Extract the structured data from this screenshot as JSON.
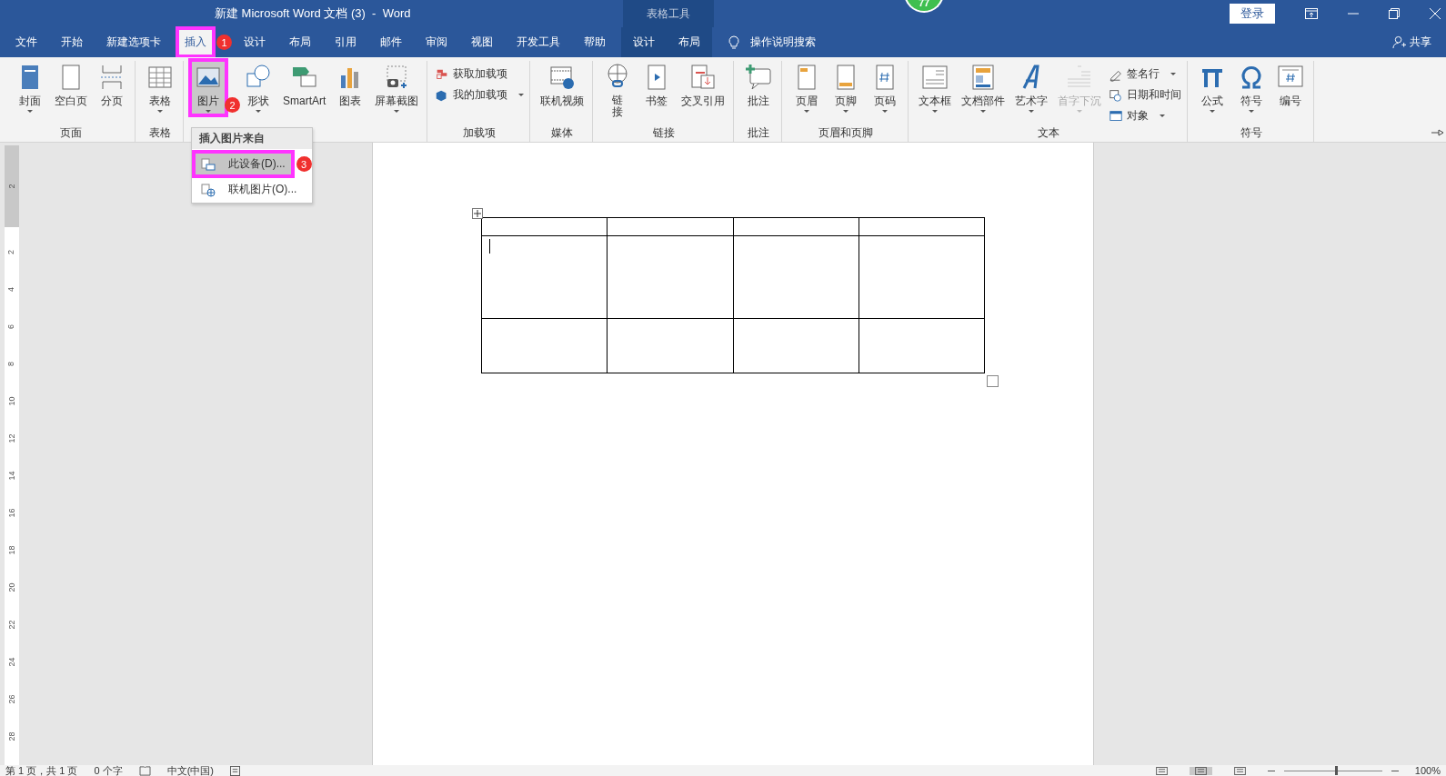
{
  "window": {
    "title": "新建 Microsoft Word 文档 (3)  -  Word",
    "context_label": "表格工具",
    "sign_in": "登录",
    "badge": "77"
  },
  "tabs": [
    {
      "label": "文件",
      "selected": false,
      "contextual": false,
      "highlighted": false
    },
    {
      "label": "开始",
      "selected": false,
      "contextual": false,
      "highlighted": false
    },
    {
      "label": "新建选项卡",
      "selected": false,
      "contextual": false,
      "highlighted": false
    },
    {
      "label": "插入",
      "selected": true,
      "contextual": false,
      "highlighted": true
    },
    {
      "label": "设计",
      "selected": false,
      "contextual": false,
      "highlighted": false
    },
    {
      "label": "布局",
      "selected": false,
      "contextual": false,
      "highlighted": false
    },
    {
      "label": "引用",
      "selected": false,
      "contextual": false,
      "highlighted": false
    },
    {
      "label": "邮件",
      "selected": false,
      "contextual": false,
      "highlighted": false
    },
    {
      "label": "审阅",
      "selected": false,
      "contextual": false,
      "highlighted": false
    },
    {
      "label": "视图",
      "selected": false,
      "contextual": false,
      "highlighted": false
    },
    {
      "label": "开发工具",
      "selected": false,
      "contextual": false,
      "highlighted": false
    },
    {
      "label": "帮助",
      "selected": false,
      "contextual": false,
      "highlighted": false
    },
    {
      "label": "设计",
      "selected": false,
      "contextual": true,
      "highlighted": false
    },
    {
      "label": "布局",
      "selected": false,
      "contextual": true,
      "highlighted": false
    }
  ],
  "tell_me": "操作说明搜索",
  "share": "共享",
  "ribbon": [
    {
      "label": "页面",
      "items": [
        {
          "kind": "large",
          "label": "封面",
          "dropdown": true,
          "disabled": false,
          "highlighted": false
        },
        {
          "kind": "large",
          "label": "空白页",
          "dropdown": false,
          "disabled": false,
          "highlighted": false
        },
        {
          "kind": "large",
          "label": "分页",
          "dropdown": false,
          "disabled": false,
          "highlighted": false
        }
      ]
    },
    {
      "label": "表格",
      "items": [
        {
          "kind": "large",
          "label": "表格",
          "dropdown": true,
          "disabled": false,
          "highlighted": false
        }
      ]
    },
    {
      "items": [
        {
          "kind": "large",
          "label": "图片",
          "dropdown": true,
          "disabled": false,
          "highlighted": true
        },
        {
          "kind": "large",
          "label": "形状",
          "dropdown": true,
          "disabled": false,
          "highlighted": false
        },
        {
          "kind": "large",
          "label": "SmartArt",
          "dropdown": false,
          "disabled": false,
          "highlighted": false
        },
        {
          "kind": "large",
          "label": "图表",
          "dropdown": false,
          "disabled": false,
          "highlighted": false
        },
        {
          "kind": "large",
          "label": "屏幕截图",
          "dropdown": true,
          "disabled": false,
          "highlighted": false
        }
      ]
    },
    {
      "label": "加载项",
      "items": [
        {
          "kind": "small",
          "label": "获取加载项",
          "dropdown": false,
          "disabled": false,
          "highlighted": false
        },
        {
          "kind": "small",
          "label": "我的加载项",
          "dropdown": true,
          "disabled": false,
          "highlighted": false
        }
      ]
    },
    {
      "label": "媒体",
      "items": [
        {
          "kind": "large",
          "label": "联机视频",
          "dropdown": false,
          "disabled": false,
          "highlighted": false
        }
      ]
    },
    {
      "label": "链接",
      "items": [
        {
          "kind": "stacked",
          "label": "链接",
          "dropdown": false,
          "disabled": false,
          "highlighted": false
        },
        {
          "kind": "large",
          "label": "书签",
          "dropdown": false,
          "disabled": false,
          "highlighted": false
        },
        {
          "kind": "large",
          "label": "交叉引用",
          "dropdown": false,
          "disabled": false,
          "highlighted": false
        }
      ]
    },
    {
      "label": "批注",
      "items": [
        {
          "kind": "large",
          "label": "批注",
          "dropdown": false,
          "disabled": false,
          "highlighted": false
        }
      ]
    },
    {
      "label": "页眉和页脚",
      "items": [
        {
          "kind": "large",
          "label": "页眉",
          "dropdown": true,
          "disabled": false,
          "highlighted": false
        },
        {
          "kind": "large",
          "label": "页脚",
          "dropdown": true,
          "disabled": false,
          "highlighted": false
        },
        {
          "kind": "large",
          "label": "页码",
          "dropdown": true,
          "disabled": false,
          "highlighted": false
        }
      ]
    },
    {
      "label": "文本",
      "items": [
        {
          "kind": "large",
          "label": "文本框",
          "dropdown": true,
          "disabled": false,
          "highlighted": false
        },
        {
          "kind": "large",
          "label": "文档部件",
          "dropdown": true,
          "disabled": false,
          "highlighted": false
        },
        {
          "kind": "large",
          "label": "艺术字",
          "dropdown": true,
          "disabled": false,
          "highlighted": false
        },
        {
          "kind": "large",
          "label": "首字下沉",
          "dropdown": true,
          "disabled": true,
          "highlighted": false
        },
        {
          "kind": "small",
          "label": "签名行",
          "dropdown": true,
          "disabled": false,
          "highlighted": false
        },
        {
          "kind": "small",
          "label": "日期和时间",
          "dropdown": false,
          "disabled": false,
          "highlighted": false
        },
        {
          "kind": "small",
          "label": "对象",
          "dropdown": true,
          "disabled": false,
          "highlighted": false
        }
      ]
    },
    {
      "label": "符号",
      "items": [
        {
          "kind": "large",
          "label": "公式",
          "dropdown": true,
          "disabled": false,
          "highlighted": false
        },
        {
          "kind": "large",
          "label": "符号",
          "dropdown": true,
          "disabled": false,
          "highlighted": false
        },
        {
          "kind": "large",
          "label": "编号",
          "dropdown": false,
          "disabled": false,
          "highlighted": false
        }
      ]
    }
  ],
  "menu": {
    "header": "插入图片来自",
    "items": [
      {
        "label": "此设备(D)...",
        "selected": true,
        "highlighted": true
      },
      {
        "label": "联机图片(O)...",
        "selected": false,
        "highlighted": false
      }
    ]
  },
  "annotations": [
    {
      "number": "1"
    },
    {
      "number": "2"
    },
    {
      "number": "3"
    }
  ],
  "ruler": [
    "2",
    "2",
    "4",
    "6",
    "8",
    "10",
    "12",
    "14",
    "16",
    "18",
    "20",
    "22",
    "24",
    "26",
    "28"
  ],
  "table": {
    "rows": [
      {
        "kind": "short",
        "cells": [
          {
            "cursor": false
          },
          {
            "cursor": false
          },
          {
            "cursor": false
          },
          {
            "cursor": false
          }
        ]
      },
      {
        "kind": "tall",
        "cells": [
          {
            "cursor": true
          },
          {
            "cursor": false
          },
          {
            "cursor": false
          },
          {
            "cursor": false
          }
        ]
      },
      {
        "kind": "medium",
        "cells": [
          {
            "cursor": false
          },
          {
            "cursor": false
          },
          {
            "cursor": false
          },
          {
            "cursor": false
          }
        ]
      }
    ]
  },
  "status_bar": {
    "items": [
      "第 1 页，共 1 页",
      "0 个字",
      "中文(中国)"
    ],
    "views": [
      {
        "selected": false
      },
      {
        "selected": true
      },
      {
        "selected": false
      }
    ],
    "zoom": {
      "level": 0.52,
      "label": "100%"
    }
  }
}
